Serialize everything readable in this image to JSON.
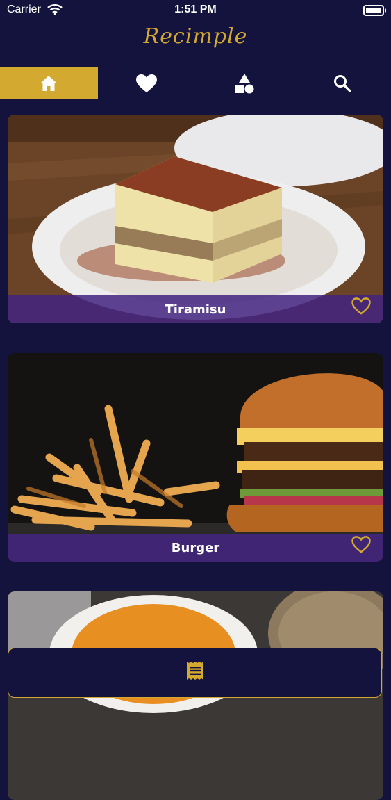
{
  "status_bar": {
    "carrier": "Carrier",
    "time": "1:51 PM"
  },
  "app": {
    "logo_text": "Recimple"
  },
  "tabs": [
    {
      "icon": "home-icon",
      "active": true
    },
    {
      "icon": "heart-icon",
      "active": false
    },
    {
      "icon": "categories-icon",
      "active": false
    },
    {
      "icon": "search-icon",
      "active": false
    }
  ],
  "recipes": [
    {
      "name": "Tiramisu",
      "favorite_icon": "heart-outline-icon"
    },
    {
      "name": "Burger",
      "favorite_icon": "heart-outline-icon"
    },
    {
      "name": "",
      "favorite_icon": ""
    }
  ],
  "bottom_bar": {
    "icon": "receipt-icon"
  },
  "colors": {
    "background": "#13133d",
    "accent": "#d3a92f",
    "caption_bar": "#422480"
  }
}
